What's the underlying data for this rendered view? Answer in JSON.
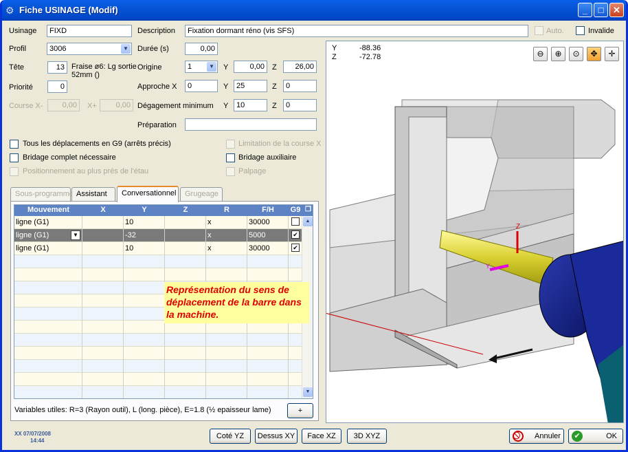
{
  "window": {
    "title": "Fiche USINAGE (Modif)"
  },
  "form": {
    "usinage_label": "Usinage",
    "usinage_value": "FIXD",
    "description_label": "Description",
    "description_value": "Fixation dormant réno (vis SFS)",
    "auto_label": "Auto.",
    "invalide_label": "Invalide",
    "profil_label": "Profil",
    "profil_value": "3006",
    "duree_label": "Durée (s)",
    "duree_value": "0,00",
    "tete_label": "Tête",
    "tete_value": "13",
    "tete_desc": "Fraise ø6: Lg sortie 52mm ()",
    "origine_label": "Origine",
    "origine_value": "1",
    "y_label": "Y",
    "z_label": "Z",
    "origine_y": "0,00",
    "origine_z": "26,00",
    "priorite_label": "Priorité",
    "priorite_value": "0",
    "approche_label": "Approche X",
    "approche_x": "0",
    "approche_y": "25",
    "approche_z": "0",
    "course_label": "Course X-",
    "course_minus": "0,00",
    "xplus_label": "X+",
    "course_plus": "0,00",
    "degagement_label": "Dégagement minimum",
    "degagement_y": "10",
    "degagement_z": "0",
    "preparation_label": "Préparation",
    "preparation_value": ""
  },
  "options": {
    "tous_deplacements": "Tous les déplacements en G9 (arrêts précis)",
    "bridage_complet": "Bridage complet nécessaire",
    "positionnement": "Positionnement au plus prés de l'étau",
    "limitation": "Limitation de la course X",
    "bridage_aux": "Bridage auxiliaire",
    "palpage": "Palpage"
  },
  "tabs": [
    "Sous-programme",
    "Assistant",
    "Conversationnel",
    "Grugeage"
  ],
  "grid": {
    "headers": [
      "Mouvement",
      "X",
      "Y",
      "Z",
      "R",
      "F/H",
      "G9"
    ],
    "rows": [
      {
        "mouvement": "ligne (G1)",
        "x": "",
        "y": "10",
        "z": "",
        "r": "x",
        "fh": "30000",
        "g9": ""
      },
      {
        "mouvement": "ligne (G1)",
        "x": "",
        "y": "-32",
        "z": "",
        "r": "x",
        "fh": "5000",
        "g9": "✔"
      },
      {
        "mouvement": "ligne (G1)",
        "x": "",
        "y": "10",
        "z": "",
        "r": "x",
        "fh": "30000",
        "g9": "✔"
      }
    ]
  },
  "variables_text": "Variables utiles: R=3 (Rayon outil), L (long. pièce), E=1.8 (½ epaisseur lame)",
  "plus_button": "+",
  "footer": {
    "user": "XX 07/07/2008",
    "time": "14:44"
  },
  "view_buttons": [
    "Coté YZ",
    "Dessus XY",
    "Face XZ",
    "3D XYZ"
  ],
  "annuler": "Annuler",
  "ok": "OK",
  "viewer": {
    "y_label": "Y",
    "y_value": "-88.36",
    "z_label": "Z",
    "z_value": "-72.78",
    "annotation": "Représentation du sens de déplacement de la barre dans la machine.",
    "axis_z": "Z",
    "axis_y": "Y"
  }
}
